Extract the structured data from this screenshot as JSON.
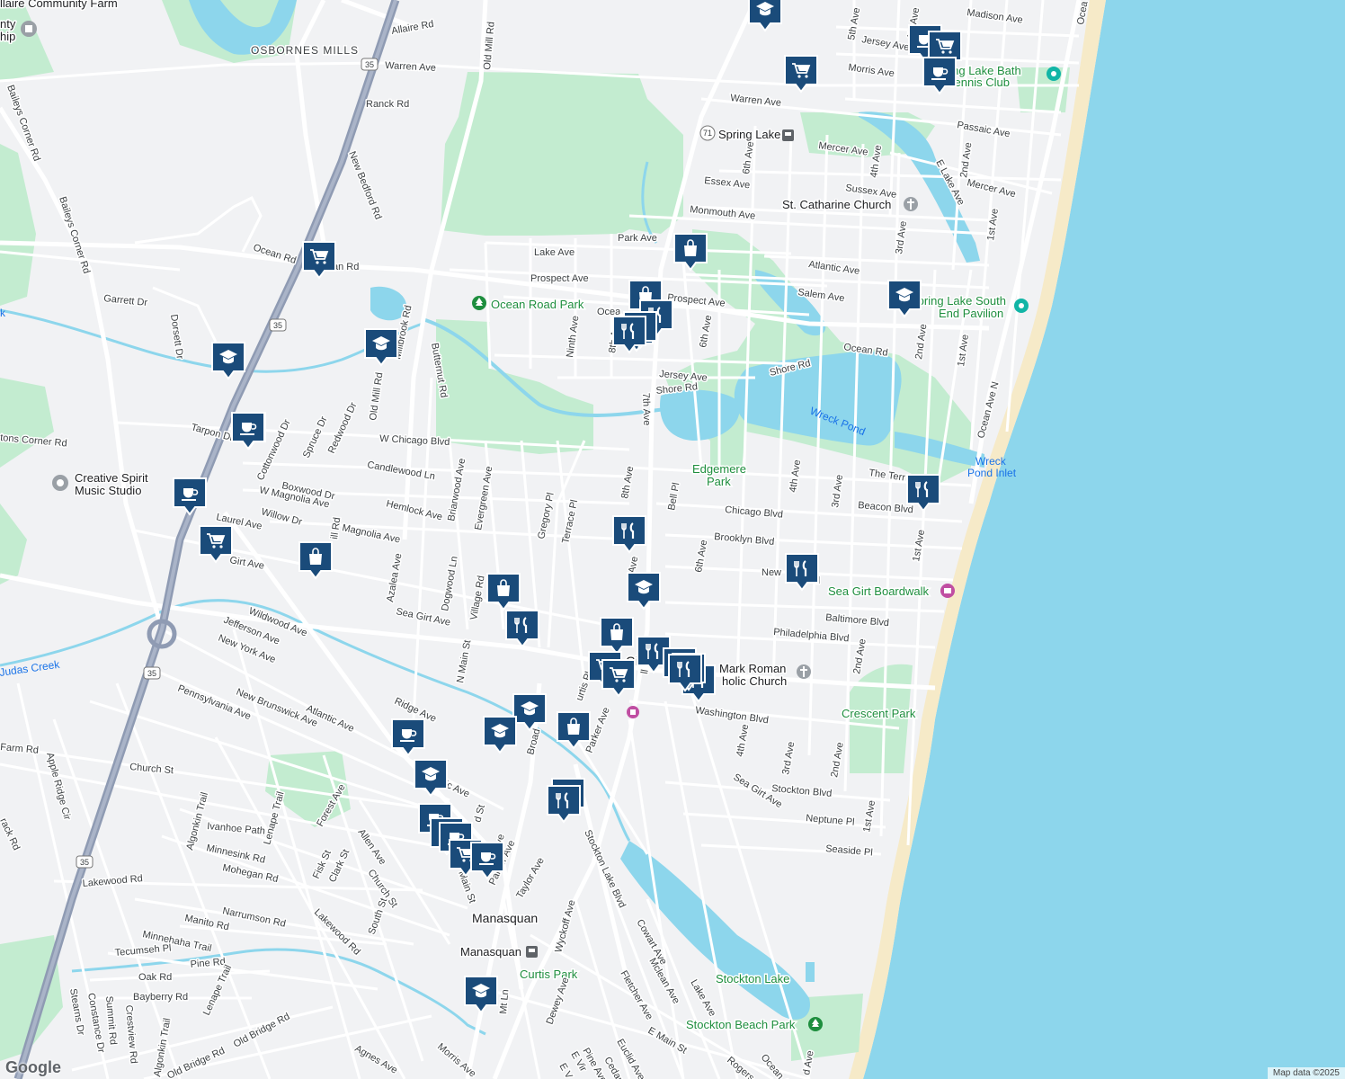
{
  "map": {
    "attribution": "Map data ©2025",
    "logo": "Google",
    "colors": {
      "land": "#f1f2f4",
      "ocean": "#8dd6ec",
      "park": "#c3ecd0",
      "beach": "#f6eac8",
      "road": "#ffffff",
      "highway": "#8f9bb3",
      "marker": "#1a4b7a"
    }
  },
  "places": [
    {
      "id": "osbornes-mills",
      "label": "OSBORNES MILLS"
    },
    {
      "id": "manasquan",
      "label": "Manasquan"
    },
    {
      "id": "ocean-road-park",
      "label": "Ocean Road Park"
    },
    {
      "id": "edgemere-park-1",
      "label": "Edgemere"
    },
    {
      "id": "edgemere-park-2",
      "label": "Park"
    },
    {
      "id": "wreck-pond",
      "label": "Wreck Pond"
    },
    {
      "id": "wreck-pond-inlet-1",
      "label": "Wreck"
    },
    {
      "id": "wreck-pond-inlet-2",
      "label": "Pond Inlet"
    },
    {
      "id": "spring-lake-bath-1",
      "label": "Spring Lake Bath"
    },
    {
      "id": "spring-lake-bath-2",
      "label": "& Tennis Club"
    },
    {
      "id": "spring-lake-south-1",
      "label": "Spring Lake South"
    },
    {
      "id": "spring-lake-south-2",
      "label": "End Pavilion"
    },
    {
      "id": "st-catharine",
      "label": "St. Catharine Church"
    },
    {
      "id": "creative-spirit-1",
      "label": "Creative Spirit"
    },
    {
      "id": "creative-spirit-2",
      "label": "Music Studio"
    },
    {
      "id": "sea-girt-boardwalk",
      "label": "Sea Girt Boardwalk"
    },
    {
      "id": "mark-roman-1",
      "label": "Mark Roman"
    },
    {
      "id": "mark-roman-2",
      "label": "holic Church"
    },
    {
      "id": "crescent-park",
      "label": "Crescent Park"
    },
    {
      "id": "curtis-park",
      "label": "Curtis Park"
    },
    {
      "id": "stockton-lake",
      "label": "Stockton Lake"
    },
    {
      "id": "stockton-beach-park",
      "label": "Stockton Beach Park"
    },
    {
      "id": "spring-lake-station",
      "label": "Spring Lake"
    },
    {
      "id": "manasquan-station",
      "label": "Manasquan"
    },
    {
      "id": "community-farm",
      "label": "llaire Community Farm"
    },
    {
      "id": "township-1",
      "label": "nty"
    },
    {
      "id": "township-2",
      "label": "hip"
    },
    {
      "id": "girt-partial",
      "label": "Gi"
    }
  ],
  "roads": [
    {
      "id": "allaire-rd",
      "label": "Allaire Rd"
    },
    {
      "id": "warren-ave-w",
      "label": "Warren Ave"
    },
    {
      "id": "warren-ave-e",
      "label": "Warren Ave"
    },
    {
      "id": "ranck-rd",
      "label": "Ranck Rd"
    },
    {
      "id": "new-bedford-rd",
      "label": "New Bedford Rd"
    },
    {
      "id": "old-mill-rd-n",
      "label": "Old Mill Rd"
    },
    {
      "id": "old-mill-rd-s",
      "label": "Old Mill Rd"
    },
    {
      "id": "baileys-corner-rd",
      "label": "Baileys Corner Rd"
    },
    {
      "id": "baileys-corner-rd-2",
      "label": "Baileys Corner Rd"
    },
    {
      "id": "ocean-rd-w",
      "label": "Ocean Rd"
    },
    {
      "id": "ocean-rd-w2",
      "label": "an Rd"
    },
    {
      "id": "ocean-rd-mid",
      "label": "Ocea"
    },
    {
      "id": "ocean-rd-e",
      "label": "Ocean Rd"
    },
    {
      "id": "garrett-dr",
      "label": "Garrett Dr"
    },
    {
      "id": "dorsett-dr",
      "label": "Dorsett Dr"
    },
    {
      "id": "millbrook-rd",
      "label": "Millbrook Rd"
    },
    {
      "id": "butternut-rd",
      "label": "Butternut Rd"
    },
    {
      "id": "lake-ave",
      "label": "Lake Ave"
    },
    {
      "id": "prospect-ave-w",
      "label": "Prospect Ave"
    },
    {
      "id": "prospect-ave-e",
      "label": "Prospect Ave"
    },
    {
      "id": "ninth-ave",
      "label": "Ninth Ave"
    },
    {
      "id": "8th-ave-n",
      "label": "8th Ave"
    },
    {
      "id": "8th-ave-s",
      "label": "8th Ave"
    },
    {
      "id": "7th-ave",
      "label": "7th Ave"
    },
    {
      "id": "jersey-ave",
      "label": "Jersey Ave"
    },
    {
      "id": "shore-rd-w",
      "label": "Shore Rd"
    },
    {
      "id": "shore-rd-e",
      "label": "Shore Rd"
    },
    {
      "id": "park-ave",
      "label": "Park Ave"
    },
    {
      "id": "6th-ave-n",
      "label": "6th Ave"
    },
    {
      "id": "6th-ave-mid",
      "label": "6th Ave"
    },
    {
      "id": "6th-ave-s",
      "label": "6th Ave"
    },
    {
      "id": "monmouth-ave",
      "label": "Monmouth Ave"
    },
    {
      "id": "essex-ave",
      "label": "Essex Ave"
    },
    {
      "id": "mercer-ave-w",
      "label": "Mercer Ave"
    },
    {
      "id": "mercer-ave-e",
      "label": "Mercer Ave"
    },
    {
      "id": "sussex-ave",
      "label": "Sussex Ave"
    },
    {
      "id": "atlantic-ave-n",
      "label": "Atlantic Ave"
    },
    {
      "id": "salem-ave",
      "label": "Salem Ave"
    },
    {
      "id": "passaic-ave",
      "label": "Passaic Ave"
    },
    {
      "id": "morris-ave-n",
      "label": "Morris Ave"
    },
    {
      "id": "madison-ave",
      "label": "Madison Ave"
    },
    {
      "id": "jersey-ave-n",
      "label": "Jersey Ave"
    },
    {
      "id": "5th-ave-n",
      "label": "5th Ave"
    },
    {
      "id": "4th-ave-n",
      "label": "4th Ave"
    },
    {
      "id": "4th-ave-n2",
      "label": "4th Ave"
    },
    {
      "id": "3rd-ave-n",
      "label": "3rd Ave"
    },
    {
      "id": "2nd-ave-n",
      "label": "2nd Ave"
    },
    {
      "id": "2nd-ave-n2",
      "label": "2nd Ave"
    },
    {
      "id": "1st-ave-n",
      "label": "1st Ave"
    },
    {
      "id": "1st-ave-n2",
      "label": "1st Ave"
    },
    {
      "id": "e-lake-ave",
      "label": "E Lake Ave"
    },
    {
      "id": "ocean-ave-n",
      "label": "Ocean Ave N"
    },
    {
      "id": "ocean-ave-top",
      "label": "Ocea"
    },
    {
      "id": "tarpon-dr",
      "label": "Tarpon Dr"
    },
    {
      "id": "corner-rd",
      "label": "tons Corner Rd"
    },
    {
      "id": "cottonwood-dr",
      "label": "Cottonwood Dr"
    },
    {
      "id": "spruce-dr",
      "label": "Spruce Dr"
    },
    {
      "id": "redwood-dr",
      "label": "Redwood Dr"
    },
    {
      "id": "w-chicago-blvd",
      "label": "W Chicago Blvd"
    },
    {
      "id": "candlewood-ln",
      "label": "Candlewood Ln"
    },
    {
      "id": "boxwood-dr",
      "label": "Boxwood Dr"
    },
    {
      "id": "hemlock-ave",
      "label": "Hemlock Ave"
    },
    {
      "id": "briarwood-ave",
      "label": "Briarwood Ave"
    },
    {
      "id": "evergreen-ave",
      "label": "Evergreen Ave"
    },
    {
      "id": "gregory-pl",
      "label": "Gregory Pl"
    },
    {
      "id": "terrace-pl",
      "label": "Terrace Pl"
    },
    {
      "id": "bell-pl-n",
      "label": "Bell Pl"
    },
    {
      "id": "bell-pl-s",
      "label": "ll Pl"
    },
    {
      "id": "4th-ave-mid",
      "label": "4th Ave"
    },
    {
      "id": "3rd-ave-mid",
      "label": "3rd Ave"
    },
    {
      "id": "beacon-blvd",
      "label": "Beacon Blvd"
    },
    {
      "id": "the-terrace",
      "label": "The Terr"
    },
    {
      "id": "chicago-blvd",
      "label": "Chicago Blvd"
    },
    {
      "id": "brooklyn-blvd",
      "label": "Brooklyn Blvd"
    },
    {
      "id": "new-york-blvd",
      "label": "New"
    },
    {
      "id": "new-york-blvd2",
      "label": "d"
    },
    {
      "id": "1st-ave-mid",
      "label": "1st Ave"
    },
    {
      "id": "w-magnolia-ave",
      "label": "W Magnolia Ave"
    },
    {
      "id": "magnolia-ave",
      "label": "Magnolia Ave"
    },
    {
      "id": "willow-dr",
      "label": "Willow Dr"
    },
    {
      "id": "laurel-ave",
      "label": "Laurel Ave"
    },
    {
      "id": "hill-rd",
      "label": "ill Rd"
    },
    {
      "id": "azalea-ave",
      "label": "Azalea Ave"
    },
    {
      "id": "dogwood-ln",
      "label": "Dogwood Ln"
    },
    {
      "id": "village-rd",
      "label": "Village Rd"
    },
    {
      "id": "girt-ave-w",
      "label": "Girt Ave"
    },
    {
      "id": "sea-girt-ave",
      "label": "Sea Girt Ave"
    },
    {
      "id": "7th-ave-mid",
      "label": "Ave"
    },
    {
      "id": "baltimore-blvd",
      "label": "Baltimore Blvd"
    },
    {
      "id": "philadelphia-blvd",
      "label": "Philadelphia Blvd"
    },
    {
      "id": "2nd-ave-mid",
      "label": "2nd Ave"
    },
    {
      "id": "wildwood-ave",
      "label": "Wildwood Ave"
    },
    {
      "id": "jefferson-ave",
      "label": "Jefferson Ave"
    },
    {
      "id": "new-york-ave",
      "label": "New York Ave"
    },
    {
      "id": "n-main-st",
      "label": "N Main St"
    },
    {
      "id": "pennsylvania-ave",
      "label": "Pennsylvania Ave"
    },
    {
      "id": "new-brunswick-ave",
      "label": "New Brunswick Ave"
    },
    {
      "id": "atlantic-ave-w",
      "label": "Atlantic Ave"
    },
    {
      "id": "ridge-ave",
      "label": "Ridge Ave"
    },
    {
      "id": "broad-st",
      "label": "Broad"
    },
    {
      "id": "curtis-pl",
      "label": "urtis Pl"
    },
    {
      "id": "parker-ave-n",
      "label": "Parker Ave"
    },
    {
      "id": "washington-blvd",
      "label": "Washington Blvd"
    },
    {
      "id": "4th-ave-s",
      "label": "4th Ave"
    },
    {
      "id": "3rd-ave-s",
      "label": "3rd Ave"
    },
    {
      "id": "2nd-ave-s",
      "label": "2nd Ave"
    },
    {
      "id": "stockton-blvd",
      "label": "Stockton Blvd"
    },
    {
      "id": "sea-girt-ave-s",
      "label": "Sea Girt Ave"
    },
    {
      "id": "neptune-pl",
      "label": "Neptune Pl"
    },
    {
      "id": "1st-ave-s",
      "label": "1st Ave"
    },
    {
      "id": "seaside-pl",
      "label": "Seaside Pl"
    },
    {
      "id": "farm-rd",
      "label": "Farm Rd"
    },
    {
      "id": "church-st-w",
      "label": "Church St"
    },
    {
      "id": "atlantic-ave-s",
      "label": "antic Ave"
    },
    {
      "id": "apple-ridge-cir",
      "label": "Apple Ridge Cir"
    },
    {
      "id": "track-rd",
      "label": "rack Rd"
    },
    {
      "id": "algonkin-trail",
      "label": "Algonkin Trail"
    },
    {
      "id": "ivanhoe-path",
      "label": "Ivanhoe Path"
    },
    {
      "id": "lenape-trail",
      "label": "Lenape Trail"
    },
    {
      "id": "forest-ave",
      "label": "Forest Ave"
    },
    {
      "id": "minnesink-rd",
      "label": "Minnesink Rd"
    },
    {
      "id": "allen-ave",
      "label": "Allen Ave"
    },
    {
      "id": "mohegan-rd",
      "label": "Mohegan Rd"
    },
    {
      "id": "fisk-st",
      "label": "Fisk St"
    },
    {
      "id": "clark-st",
      "label": "Clark St"
    },
    {
      "id": "church-st-s",
      "label": "Church St"
    },
    {
      "id": "lakewood-rd-w",
      "label": "Lakewood Rd"
    },
    {
      "id": "narrumson-rd",
      "label": "Narrumson Rd"
    },
    {
      "id": "lakewood-rd",
      "label": "Lakewood Rd"
    },
    {
      "id": "south-st",
      "label": "South St"
    },
    {
      "id": "manito-rd",
      "label": "Manito Rd"
    },
    {
      "id": "minnehaha-trail",
      "label": "Minnehaha Trail"
    },
    {
      "id": "tecumseh-pl",
      "label": "Tecumseh Pl"
    },
    {
      "id": "pine-rd",
      "label": "Pine Rd"
    },
    {
      "id": "oak-rd",
      "label": "Oak Rd"
    },
    {
      "id": "bayberry-rd",
      "label": "Bayberry Rd"
    },
    {
      "id": "lenape-trail-s",
      "label": "Lenape Trail"
    },
    {
      "id": "stearns-dr",
      "label": "Stearns Dr"
    },
    {
      "id": "constance-dr",
      "label": "Constance Dr"
    },
    {
      "id": "summit-rd",
      "label": "Summit Rd"
    },
    {
      "id": "crestview-rd",
      "label": "Crestview Rd"
    },
    {
      "id": "algonkin-trail-s",
      "label": "Algonkin Trail"
    },
    {
      "id": "old-bridge-rd-n",
      "label": "Old Bridge Rd"
    },
    {
      "id": "old-bridge-rd-s",
      "label": "Old Bridge Rd"
    },
    {
      "id": "agnes-ave",
      "label": "Agnes Ave"
    },
    {
      "id": "morris-ave-s",
      "label": "Morris Ave"
    },
    {
      "id": "mt-ln",
      "label": "Mt Ln"
    },
    {
      "id": "taylor-ave",
      "label": "Taylor Ave"
    },
    {
      "id": "parker-ave-s",
      "label": "Parker Ave"
    },
    {
      "id": "main-st",
      "label": "Main St"
    },
    {
      "id": "st-partial",
      "label": "d St"
    },
    {
      "id": "ave-partial",
      "label": "ve"
    },
    {
      "id": "wyckoff-ave",
      "label": "Wyckoff Ave"
    },
    {
      "id": "dewey-ave",
      "label": "Dewey Ave"
    },
    {
      "id": "stockton-lake-blvd",
      "label": "Stockton Lake Blvd"
    },
    {
      "id": "cowart-ave",
      "label": "Cowart Ave"
    },
    {
      "id": "mclean-ave",
      "label": "Mclean Ave"
    },
    {
      "id": "lake-ave-s",
      "label": "Lake Ave"
    },
    {
      "id": "fletcher-ave",
      "label": "Fletcher Ave"
    },
    {
      "id": "e-main-st",
      "label": "E Main St"
    },
    {
      "id": "euclid-ave",
      "label": "Euclid Ave"
    },
    {
      "id": "pine-ave",
      "label": "Pine Ave"
    },
    {
      "id": "cedar-ave",
      "label": "Cedar Av"
    },
    {
      "id": "e-virginia",
      "label": "E Vir"
    },
    {
      "id": "e-v",
      "label": "E V"
    },
    {
      "id": "rogers-ave",
      "label": "Rogers"
    },
    {
      "id": "ocean-ave-s",
      "label": "Ocean Ave"
    },
    {
      "id": "d-ave",
      "label": "d Ave"
    }
  ],
  "shields": [
    {
      "id": "rt35-n",
      "label": "35"
    },
    {
      "id": "rt35-mid",
      "label": "35"
    },
    {
      "id": "rt35-roundabout",
      "label": "35"
    },
    {
      "id": "rt35-s",
      "label": "35"
    },
    {
      "id": "rt71",
      "label": "71"
    }
  ],
  "waterways": [
    {
      "id": "judas-creek",
      "label": "Judas Creek"
    },
    {
      "id": "creek-w",
      "label": "k"
    }
  ],
  "markers": [
    {
      "id": "m1",
      "icon": "school-icon"
    },
    {
      "id": "m2",
      "icon": "cafe-icon"
    },
    {
      "id": "m3",
      "icon": "grocery-icon"
    },
    {
      "id": "m4",
      "icon": "cafe-icon"
    },
    {
      "id": "m5",
      "icon": "grocery-icon"
    },
    {
      "id": "m6",
      "icon": "shopping-icon"
    },
    {
      "id": "m7",
      "icon": "grocery-icon"
    },
    {
      "id": "m8",
      "icon": "school-icon"
    },
    {
      "id": "m9",
      "icon": "school-icon"
    },
    {
      "id": "m10",
      "icon": "shopping-icon"
    },
    {
      "id": "m11",
      "icon": "shopping-icon"
    },
    {
      "id": "m12",
      "icon": "restaurant-icon"
    },
    {
      "id": "m13",
      "icon": "restaurant-icon"
    },
    {
      "id": "m14",
      "icon": "cafe-icon"
    },
    {
      "id": "m15",
      "icon": "cafe-icon"
    },
    {
      "id": "m16",
      "icon": "grocery-icon"
    },
    {
      "id": "m17",
      "icon": "shopping-icon"
    },
    {
      "id": "m18",
      "icon": "restaurant-icon"
    },
    {
      "id": "m19",
      "icon": "restaurant-icon"
    },
    {
      "id": "m20",
      "icon": "restaurant-icon"
    },
    {
      "id": "m21",
      "icon": "school-icon"
    },
    {
      "id": "m22",
      "icon": "shopping-icon"
    },
    {
      "id": "m23",
      "icon": "shopping-icon"
    },
    {
      "id": "m24",
      "icon": "grocery-icon"
    },
    {
      "id": "m25",
      "icon": "restaurant-icon"
    },
    {
      "id": "m26",
      "icon": "restaurant-icon"
    },
    {
      "id": "m27",
      "icon": "restaurant-icon"
    },
    {
      "id": "m28",
      "icon": "restaurant-icon"
    },
    {
      "id": "m29",
      "icon": "school-icon"
    },
    {
      "id": "m30",
      "icon": "school-icon"
    },
    {
      "id": "m31",
      "icon": "shopping-icon"
    },
    {
      "id": "m32",
      "icon": "cafe-icon"
    },
    {
      "id": "m33",
      "icon": "school-icon"
    },
    {
      "id": "m34",
      "icon": "restaurant-icon"
    },
    {
      "id": "m35",
      "icon": "restaurant-icon"
    },
    {
      "id": "m36",
      "icon": "cafe-icon"
    },
    {
      "id": "m37",
      "icon": "cafe-icon"
    },
    {
      "id": "m38",
      "icon": "cafe-icon"
    },
    {
      "id": "m39",
      "icon": "grocery-icon"
    },
    {
      "id": "m40",
      "icon": "cafe-icon"
    },
    {
      "id": "m41",
      "icon": "school-icon"
    },
    {
      "id": "m42",
      "icon": "restaurant-icon"
    },
    {
      "id": "m43",
      "icon": "school-icon"
    },
    {
      "id": "m44",
      "icon": "restaurant-icon"
    },
    {
      "id": "m45",
      "icon": "restaurant-icon"
    },
    {
      "id": "m46",
      "icon": "restaurant-icon"
    },
    {
      "id": "m47",
      "icon": "grocery-icon"
    },
    {
      "id": "m48",
      "icon": "cafe-icon"
    },
    {
      "id": "m49",
      "icon": "restaurant-icon"
    }
  ]
}
